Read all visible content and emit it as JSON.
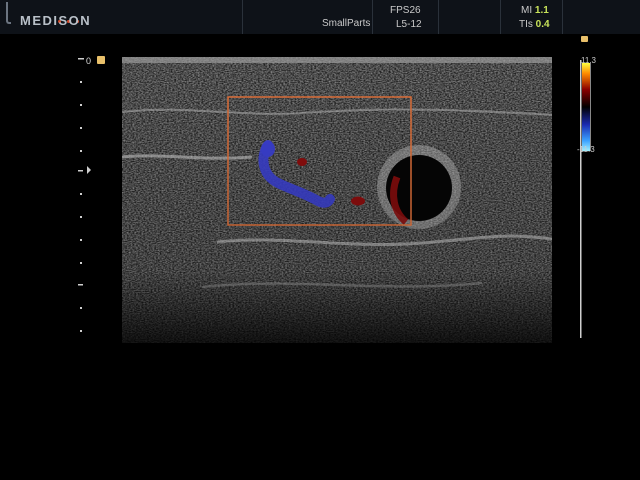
{
  "header": {
    "brand": "MEDISON",
    "preset": "SmallParts",
    "fps": "FPS26",
    "probe": "L5-12",
    "mi_label": "MI",
    "mi_value": "1.1",
    "tis_label": "TIs",
    "tis_value": "0.4"
  },
  "depth_scale": {
    "zero_label": "0"
  },
  "color_scale": {
    "top_label": "11.3",
    "bottom_label": "-11.3"
  },
  "colors": {
    "roi_box": "#e0703a",
    "accent_value": "#c8e35a",
    "flow_blue": "#3a3fd0",
    "flow_red": "#8a0d0d",
    "marker": "#e8c06a"
  }
}
